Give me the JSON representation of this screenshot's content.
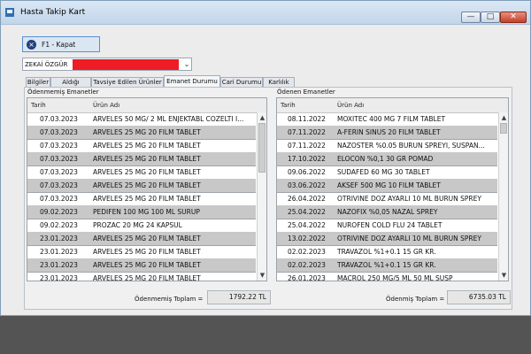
{
  "window": {
    "title": "Hasta Takip Kart",
    "min_glyph": "—",
    "max_glyph": "□",
    "close_glyph": "✕"
  },
  "toolbar": {
    "kapat_icon": "×",
    "kapat_label": "F1 - Kapat"
  },
  "patient": {
    "name_prefix": "ZEKAİ ÖZGÜR",
    "arrow": "⌄"
  },
  "tabs": [
    "Bilgiler",
    "Aldığı Ürünler",
    "Tavsiye Edilen Ürünler",
    "Emanet Durumu",
    "Cari Durumu",
    "Karlılık"
  ],
  "active_tab": "Emanet Durumu",
  "left": {
    "title": "Ödenmemiş Emanetler",
    "col_date": "Tarih",
    "col_product": "Ürün Adı",
    "rows": [
      {
        "date": "07.03.2023",
        "product": "ARVELES 50 MG/ 2 ML ENJEKTABL COZELTI I..."
      },
      {
        "date": "07.03.2023",
        "product": "ARVELES 25 MG 20 FILM TABLET"
      },
      {
        "date": "07.03.2023",
        "product": "ARVELES 25 MG 20 FILM TABLET"
      },
      {
        "date": "07.03.2023",
        "product": "ARVELES 25 MG 20 FILM TABLET"
      },
      {
        "date": "07.03.2023",
        "product": "ARVELES 25 MG 20 FILM TABLET"
      },
      {
        "date": "07.03.2023",
        "product": "ARVELES 25 MG 20 FILM TABLET"
      },
      {
        "date": "07.03.2023",
        "product": "ARVELES 25 MG 20 FILM TABLET"
      },
      {
        "date": "09.02.2023",
        "product": "PEDIFEN 100 MG 100 ML SURUP"
      },
      {
        "date": "09.02.2023",
        "product": "PROZAC 20 MG 24 KAPSUL"
      },
      {
        "date": "23.01.2023",
        "product": "ARVELES 25 MG 20 FILM TABLET"
      },
      {
        "date": "23.01.2023",
        "product": "ARVELES 25 MG 20 FILM TABLET"
      },
      {
        "date": "23.01.2023",
        "product": "ARVELES 25 MG 20 FILM TABLET"
      },
      {
        "date": "23.01.2023",
        "product": "ARVELES 25 MG 20 FILM TABLET"
      }
    ],
    "total_label": "Ödenmemiş Toplam =",
    "total_value": "1792.22 TL"
  },
  "right": {
    "title": "Ödenen Emanetler",
    "col_date": "Tarih",
    "col_product": "Ürün Adı",
    "rows": [
      {
        "date": "08.11.2022",
        "product": "MOXITEC 400 MG 7 FILM TABLET"
      },
      {
        "date": "07.11.2022",
        "product": "A-FERIN SINUS 20 FILM TABLET"
      },
      {
        "date": "07.11.2022",
        "product": "NAZOSTER %0.05 BURUN SPREYI, SUSPAN..."
      },
      {
        "date": "17.10.2022",
        "product": "ELOCON %0,1 30 GR POMAD"
      },
      {
        "date": "09.06.2022",
        "product": "SUDAFED 60 MG 30 TABLET"
      },
      {
        "date": "03.06.2022",
        "product": "AKSEF 500 MG 10 FILM TABLET"
      },
      {
        "date": "26.04.2022",
        "product": "OTRIVINE DOZ AYARLI 10 ML  BURUN  SPREY"
      },
      {
        "date": "25.04.2022",
        "product": "NAZOFIX %0,05 NAZAL SPREY"
      },
      {
        "date": "25.04.2022",
        "product": "NUROFEN COLD FLU 24 TABLET"
      },
      {
        "date": "13.02.2022",
        "product": "OTRIVINE DOZ AYARLI 10 ML  BURUN  SPREY"
      },
      {
        "date": "02.02.2023",
        "product": "TRAVAZOL %1+0.1 15 GR KR."
      },
      {
        "date": "02.02.2023",
        "product": "TRAVAZOL %1+0.1 15 GR KR."
      },
      {
        "date": "26.01.2023",
        "product": "MACROL 250 MG/5 ML 50 ML SUSP"
      }
    ],
    "total_label": "Ödenmiş Toplam =",
    "total_value": "6735.03 TL"
  },
  "scroll": {
    "up": "▲",
    "down": "▼"
  }
}
